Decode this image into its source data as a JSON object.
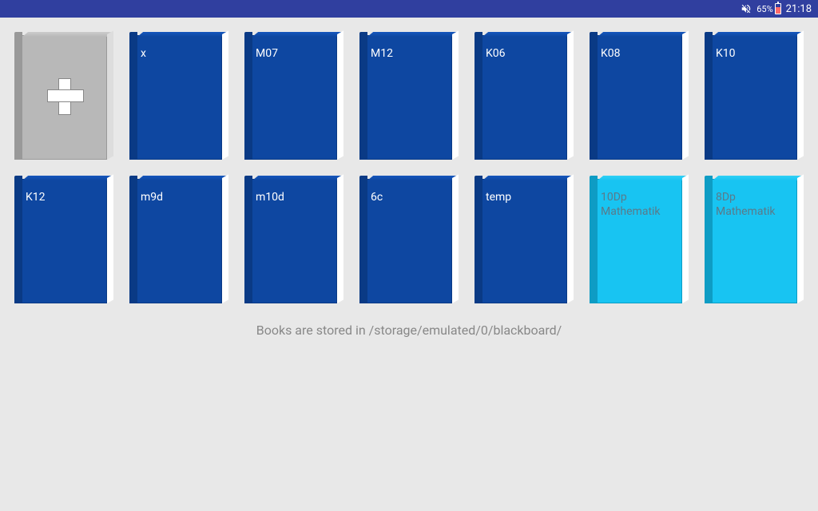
{
  "status": {
    "battery_pct": "65%",
    "time": "21:18"
  },
  "books": [
    {
      "label": "x",
      "variant": "blue"
    },
    {
      "label": "M07",
      "variant": "blue"
    },
    {
      "label": "M12",
      "variant": "blue"
    },
    {
      "label": "K06",
      "variant": "blue"
    },
    {
      "label": "K08",
      "variant": "blue"
    },
    {
      "label": "K10",
      "variant": "blue"
    },
    {
      "label": "K12",
      "variant": "blue"
    },
    {
      "label": "m9d",
      "variant": "blue"
    },
    {
      "label": "m10d",
      "variant": "blue"
    },
    {
      "label": "6c",
      "variant": "blue"
    },
    {
      "label": "temp",
      "variant": "blue"
    },
    {
      "label": "10Dp Mathematik",
      "variant": "cyan"
    },
    {
      "label": "8Dp Mathematik",
      "variant": "cyan"
    }
  ],
  "footer": "Books are stored in /storage/emulated/0/blackboard/"
}
